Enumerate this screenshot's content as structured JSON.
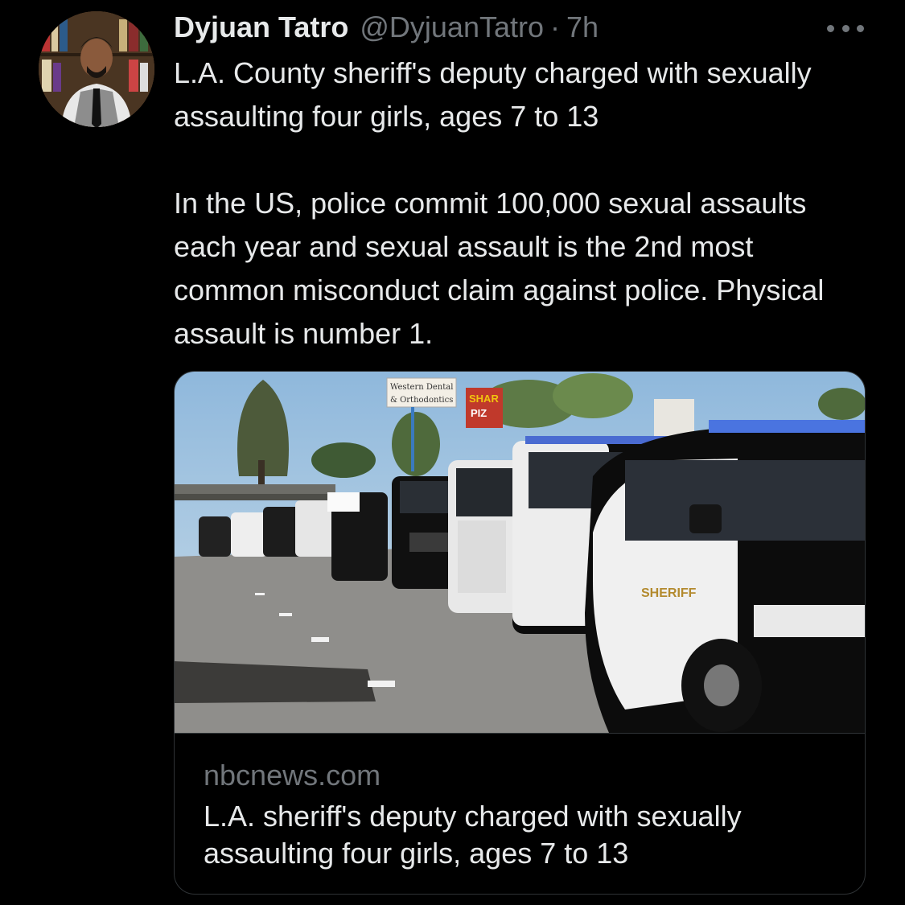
{
  "tweet": {
    "author_name": "Dyjuan Tatro",
    "handle": "@DyjuanTatro",
    "separator": "·",
    "time": "7h",
    "more_icon": "more-horizontal-icon",
    "text_paragraph_1": "L.A. County sheriff's deputy charged with sexually assaulting four girls, ages 7 to 13",
    "text_paragraph_2": "In the US, police commit 100,000 sexual assaults each year and sexual assault is the 2nd most common misconduct claim against police. Physical assault is number 1."
  },
  "link_card": {
    "domain": "nbcnews.com",
    "title": "L.A. sheriff's deputy charged with sexually assaulting four girls, ages 7 to 13",
    "image_sign_1": "Western Dental",
    "image_sign_2": "& Orthodontics",
    "image_sign_3": "SHAR",
    "image_sign_4": "PIZ",
    "image_door_text": "SHERIFF"
  },
  "colors": {
    "background": "#000000",
    "text_primary": "#e7e9ea",
    "text_secondary": "#71767b",
    "border": "#2f3336"
  }
}
